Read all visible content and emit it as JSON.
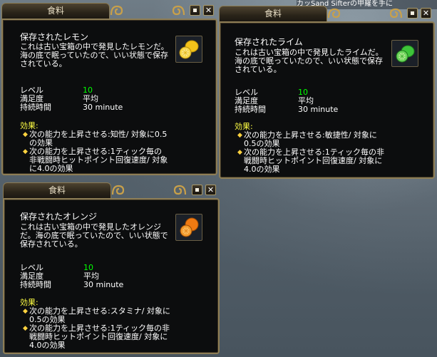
{
  "background": {
    "top_text": "カッSand Sifterの甲羅を手に"
  },
  "windows": [
    {
      "tab_title": "食料",
      "item_name": "保存されたレモン",
      "description": "これは古い宝箱の中で発見したレモンだ。海の底で眠っていたので、いい状態で保存されている。",
      "icon": "lemon-icon",
      "icon_color": "#f2c21a",
      "stats": [
        {
          "label": "レベル",
          "value": "10"
        },
        {
          "label": "満足度",
          "value": "平均"
        },
        {
          "label": "持続時間",
          "value": "30 minute"
        }
      ],
      "effects_title": "効果:",
      "effects": [
        "次の能力を上昇させる:知性/ 対象に0.5の効果",
        "次の能力を上昇させる:1ティック毎の非戦闘時ヒットポイント回復速度/ 対象に4.0の効果"
      ]
    },
    {
      "tab_title": "食料",
      "item_name": "保存されたライム",
      "description": "これは古い宝箱の中で発見したライムだ。海の底で眠っていたので、いい状態で保存されている。",
      "icon": "lime-icon",
      "icon_color": "#3ec43a",
      "stats": [
        {
          "label": "レベル",
          "value": "10"
        },
        {
          "label": "満足度",
          "value": "平均"
        },
        {
          "label": "持続時間",
          "value": "30 minute"
        }
      ],
      "effects_title": "効果:",
      "effects": [
        "次の能力を上昇させる:敏捷性/ 対象に0.5の効果",
        "次の能力を上昇させる:1ティック毎の非戦闘時ヒットポイント回復速度/ 対象に4.0の効果"
      ]
    },
    {
      "tab_title": "食料",
      "item_name": "保存されたオレンジ",
      "description": "これは古い宝箱の中で発見したオレンジだ。海の底で眠っていたので、いい状態で保存されている。",
      "icon": "orange-icon",
      "icon_color": "#f07a12",
      "stats": [
        {
          "label": "レベル",
          "value": "10"
        },
        {
          "label": "満足度",
          "value": "平均"
        },
        {
          "label": "持続時間",
          "value": "30 minute"
        }
      ],
      "effects_title": "効果:",
      "effects": [
        "次の能力を上昇させる:スタミナ/ 対象に0.5の効果",
        "次の能力を上昇させる:1ティック毎の非戦闘時ヒットポイント回復速度/ 対象に4.0の効果"
      ]
    }
  ],
  "controls": {
    "pin_icon": "pin-icon",
    "close_glyph": "✕",
    "bullet": "◆"
  }
}
